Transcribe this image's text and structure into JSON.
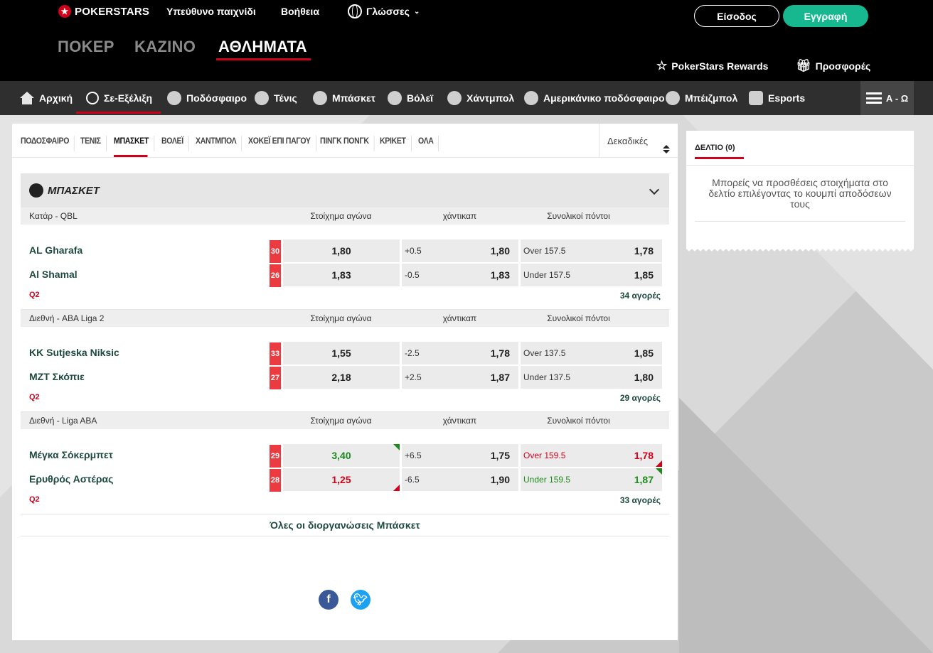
{
  "brand": {
    "logo_text": "POKERSTARS"
  },
  "header": {
    "links": [
      "Υπεύθυνο παιχνίδι",
      "Βοήθεια"
    ],
    "language": "Γλώσσες",
    "login": "Είσοδος",
    "register": "Εγγραφή",
    "verticals": [
      "ΠΟΚΕΡ",
      "ΚΑΖΙΝΟ",
      "ΑΘΛΗΜΑΤΑ"
    ],
    "rewards": "PokerStars Rewards",
    "offers": "Προσφορές"
  },
  "sportnav": {
    "items": [
      "Αρχική",
      "Σε-Εξέλιξη",
      "Ποδόσφαιρο",
      "Τένις",
      "Μπάσκετ",
      "Βόλεϊ",
      "Χάντμπολ",
      "Αμερικάνικο ποδόσφαιρο",
      "Μπέιζμπολ",
      "Esports"
    ],
    "az": "Α - Ω"
  },
  "subtabs": [
    "ΠΟΔΟΣΦΑΙΡΟ",
    "ΤΕΝΙΣ",
    "ΜΠΑΣΚΕΤ",
    "ΒΟΛΕΪ",
    "ΧΑΝΤΜΠΟΛ",
    "ΧΟΚΕΪ ΕΠΙ ΠΑΓΟΥ",
    "ΠΙΝΓΚ ΠΟΝΓΚ",
    "ΚΡΙΚΕΤ",
    "ΟΛΑ"
  ],
  "odds_format": "Δεκαδικές",
  "section": {
    "title": "ΜΠΑΣΚΕΤ"
  },
  "columns": {
    "match": "Στοίχημα αγώνα",
    "handicap": "χάντικαπ",
    "totals": "Συνολικοί πόντοι"
  },
  "competitions": [
    {
      "name": "Κατάρ - QBL",
      "teams": [
        {
          "name": "AL Gharafa",
          "score": "30",
          "match_odd": "1,80",
          "hc_line": "+0.5",
          "hc_odd": "1,80",
          "tot_line": "Over 157.5",
          "tot_odd": "1,78"
        },
        {
          "name": "Al Shamal",
          "score": "26",
          "match_odd": "1,83",
          "hc_line": "-0.5",
          "hc_odd": "1,83",
          "tot_line": "Under 157.5",
          "tot_odd": "1,85"
        }
      ],
      "period": "Q2",
      "markets": "34 αγορές"
    },
    {
      "name": "Διεθνή - ABA Liga 2",
      "teams": [
        {
          "name": "KK Sutjeska Niksic",
          "score": "33",
          "match_odd": "1,55",
          "hc_line": "-2.5",
          "hc_odd": "1,78",
          "tot_line": "Over 137.5",
          "tot_odd": "1,85"
        },
        {
          "name": "MZT Σκόπιε",
          "score": "27",
          "match_odd": "2,18",
          "hc_line": "+2.5",
          "hc_odd": "1,87",
          "tot_line": "Under 137.5",
          "tot_odd": "1,80"
        }
      ],
      "period": "Q2",
      "markets": "29 αγορές"
    },
    {
      "name": "Διεθνή - Liga ABA",
      "teams": [
        {
          "name": "Μέγκα Σόκερμπετ",
          "score": "29",
          "match_odd": "3,40",
          "hc_line": "+6.5",
          "hc_odd": "1,75",
          "tot_line": "Over 159.5",
          "tot_odd": "1,78"
        },
        {
          "name": "Ερυθρός Αστέρας",
          "score": "28",
          "match_odd": "1,25",
          "hc_line": "-6.5",
          "hc_odd": "1,90",
          "tot_line": "Under 159.5",
          "tot_odd": "1,87"
        }
      ],
      "period": "Q2",
      "markets": "33 αγορές"
    }
  ],
  "all_competitions": "Όλες οι διοργανώσεις Μπάσκετ",
  "betslip": {
    "tab": "ΔΕΛΤΙΟ",
    "count": "(0)",
    "message": "Μπορείς να προσθέσεις στοιχήματα στο δελτίο επιλέγοντας το κουμπί αποδόσεων τους"
  },
  "colors": {
    "accent_red": "#d0021b",
    "register_green": "#17b890",
    "team_text": "#1e4a3f",
    "odds_up": "#1e8a1e",
    "odds_down": "#d0021b"
  }
}
